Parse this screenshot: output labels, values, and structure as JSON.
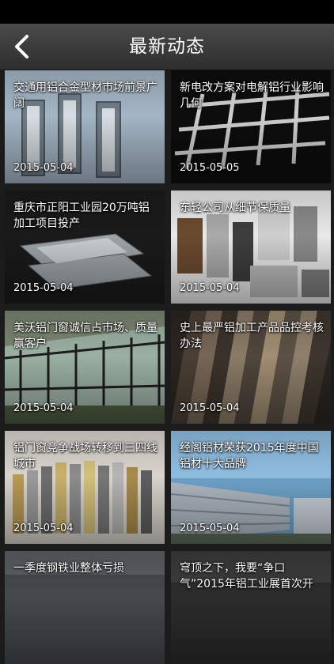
{
  "header": {
    "title": "最新动态",
    "back_icon": "chevron-left-icon"
  },
  "news": [
    {
      "title": "交通用铝合金型材市场前景广阔",
      "date": "2015-05-04"
    },
    {
      "title": "新电改方案对电解铝行业影响几何",
      "date": "2015-05-05"
    },
    {
      "title": "重庆市正阳工业园20万吨铝加工项目投产",
      "date": "2015-05-04"
    },
    {
      "title": "东轻公司从细节保质量",
      "date": "2015-05-04"
    },
    {
      "title": "美沃铝门窗诚信占市场、质量赢客户",
      "date": "2015-05-04"
    },
    {
      "title": "史上最严铝加工产品品控考核办法",
      "date": "2015-05-04"
    },
    {
      "title": "铝门窗竞争战场转移到三四线城市",
      "date": "2015-05-04"
    },
    {
      "title": "经阁铝材荣获2015年度中国铝材十大品牌",
      "date": "2015-05-04"
    },
    {
      "title": "一季度钢铁业整体亏损",
      "date": ""
    },
    {
      "title": "穹顶之下，我要“争口气”2015年铝工业展首次开",
      "date": ""
    }
  ]
}
